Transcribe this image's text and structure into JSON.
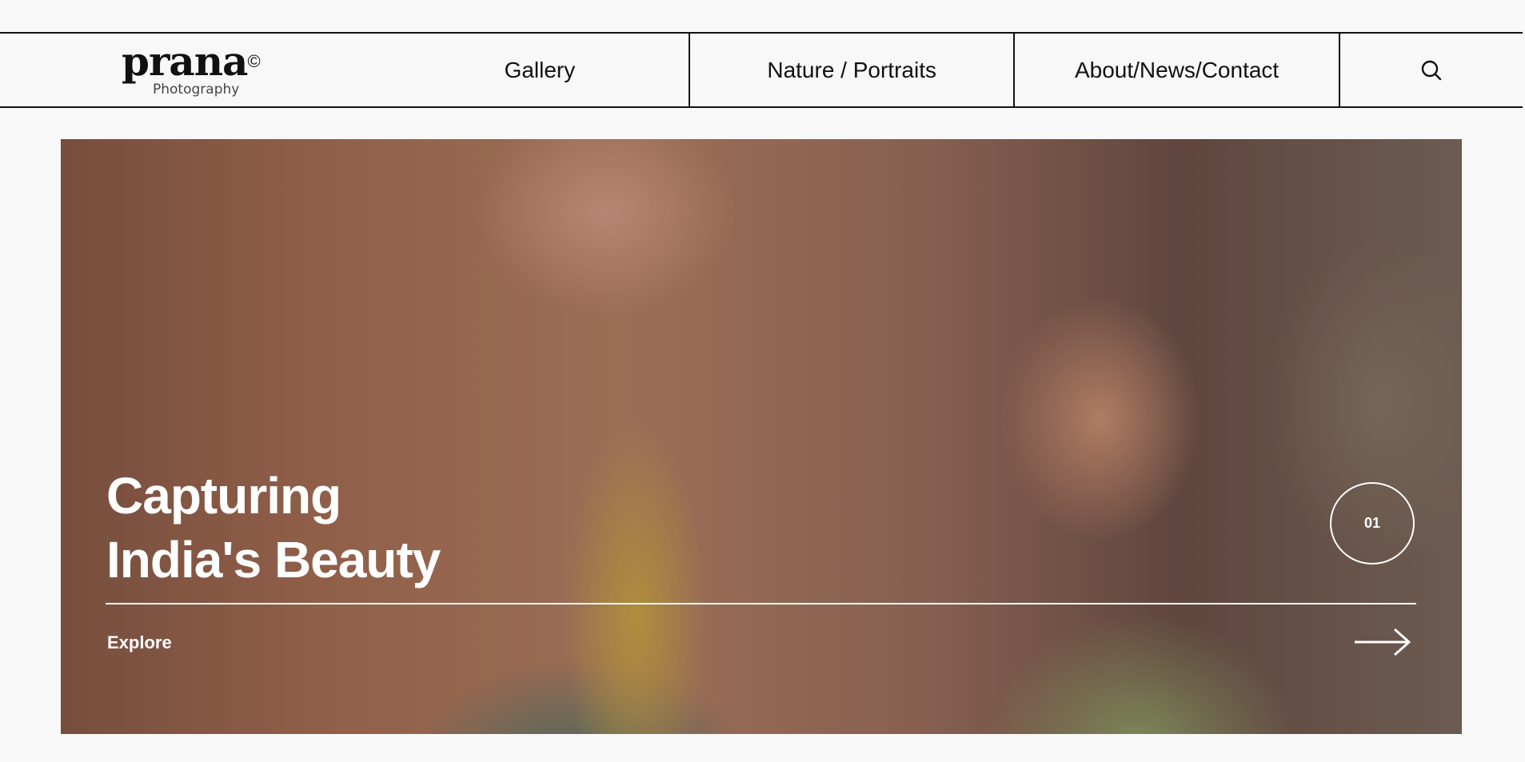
{
  "header": {
    "logo_main": "prana",
    "logo_mark": "©",
    "logo_sub": "Photography",
    "nav": [
      {
        "label": "Gallery"
      },
      {
        "label": "Nature / Portraits"
      },
      {
        "label": "About/News/Contact"
      }
    ],
    "search_icon": "search-icon"
  },
  "hero": {
    "title_line1": "Capturing",
    "title_line2": "India's Beauty",
    "slide_number": "01",
    "explore_label": "Explore",
    "arrow_icon": "arrow-right-icon"
  },
  "colors": {
    "background": "#f8f8f8",
    "text": "#111111",
    "hero_text": "#ffffff"
  }
}
